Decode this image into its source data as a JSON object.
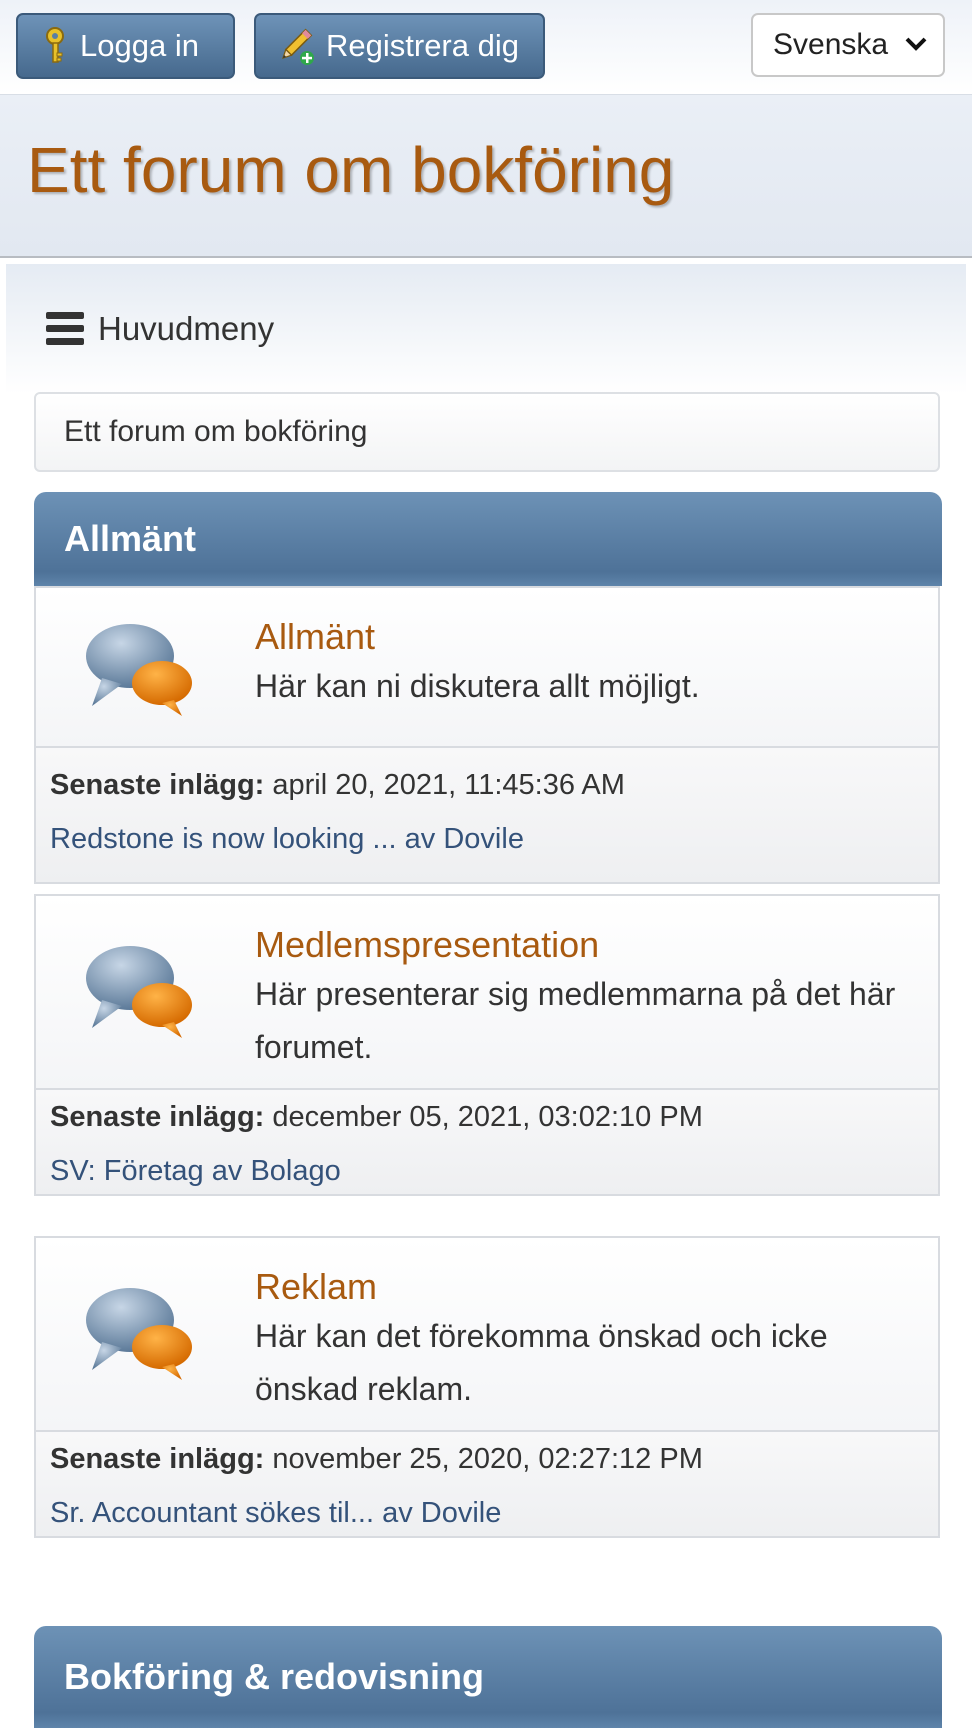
{
  "topbar": {
    "login_label": "Logga in",
    "register_label": "Registrera dig",
    "language": "Svenska"
  },
  "header": {
    "forum_title": "Ett forum om bokföring"
  },
  "nav": {
    "menu_label": "Huvudmeny",
    "breadcrumb": "Ett forum om bokföring"
  },
  "categories": [
    {
      "title": "Allmänt",
      "boards": [
        {
          "name": "Allmänt",
          "description": "Här kan ni diskutera allt möjligt.",
          "last_post_label": "Senaste inlägg:",
          "last_post_date": "april 20, 2021, 11:45:36 AM",
          "last_post_topic": "Redstone is now looking ...",
          "last_post_by": "av",
          "last_post_author": "Dovile"
        },
        {
          "name": "Medlemspresentation",
          "description": "Här presenterar sig medlemmarna på det här forumet.",
          "last_post_label": "Senaste inlägg:",
          "last_post_date": "december 05, 2021, 03:02:10 PM",
          "last_post_topic": "SV: Företag",
          "last_post_by": "av",
          "last_post_author": "Bolago"
        },
        {
          "name": "Reklam",
          "description": "Här kan det förekomma önskad och icke önskad reklam.",
          "last_post_label": "Senaste inlägg:",
          "last_post_date": "november 25, 2020, 02:27:12 PM",
          "last_post_topic": "Sr. Accountant sökes til...",
          "last_post_by": "av",
          "last_post_author": "Dovile"
        }
      ]
    },
    {
      "title": "Bokföring & redovisning"
    }
  ],
  "colors": {
    "accent_orange": "#a85a10",
    "category_blue": "#5a7fa4",
    "link_blue": "#34527a"
  },
  "icons": {
    "login": "key-icon",
    "register": "pencil-plus-icon",
    "language": "chevron-down-icon",
    "menu": "hamburger-icon",
    "board": "speech-bubbles-icon"
  }
}
